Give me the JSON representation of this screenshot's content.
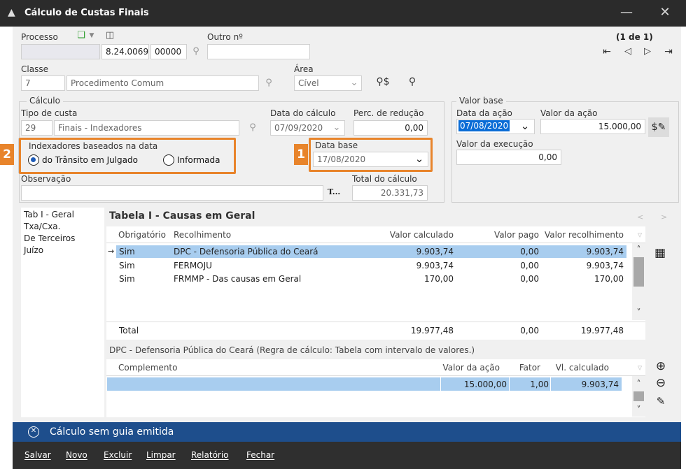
{
  "window": {
    "title": "Cálculo de Custas Finais"
  },
  "processo": {
    "label": "Processo",
    "numero": "8.24.0069",
    "sufixo": "00000",
    "outro_label": "Outro nº",
    "outro_value": ""
  },
  "paging": {
    "text": "(1 de 1)"
  },
  "classe": {
    "label": "Classe",
    "codigo": "7",
    "descricao": "Procedimento Comum"
  },
  "area": {
    "label": "Área",
    "value": "Cível"
  },
  "calculo": {
    "group_label": "Cálculo",
    "tipo_label": "Tipo de custa",
    "tipo_codigo": "29",
    "tipo_descricao": "Finais - Indexadores",
    "data_label": "Data do cálculo",
    "data_value": "07/09/2020",
    "perc_label": "Perc. de redução",
    "perc_value": "0,00",
    "indexadores_label": "Indexadores baseados na data",
    "radio1": "do Trânsito em Julgado",
    "radio2": "Informada",
    "data_base_label": "Data base",
    "data_base_value": "17/08/2020",
    "obs_label": "Observação",
    "t_button": "T...",
    "total_label": "Total do cálculo",
    "total_value": "20.331,73"
  },
  "valor_base": {
    "group_label": "Valor base",
    "data_acao_label": "Data da ação",
    "data_acao_value": "07/08/2020",
    "valor_acao_label": "Valor da ação",
    "valor_acao_value": "15.000,00",
    "valor_exec_label": "Valor da execução",
    "valor_exec_value": "0,00"
  },
  "badges": {
    "one": "1",
    "two": "2"
  },
  "tabs": [
    "Tab I - Geral",
    "Txa/Cxa.",
    "De Terceiros",
    "Juízo"
  ],
  "tabela": {
    "title": "Tabela I - Causas em Geral",
    "nav_prev": "<",
    "nav_next": ">",
    "headers": {
      "obrig": "Obrigatório",
      "recolh": "Recolhimento",
      "vcalc": "Valor calculado",
      "vpago": "Valor pago",
      "vrecolh": "Valor recolhimento"
    },
    "rows": [
      {
        "obrig": "Sim",
        "recolh": "DPC - Defensoria Pública do Ceará",
        "vcalc": "9.903,74",
        "vpago": "0,00",
        "vrecolh": "9.903,74"
      },
      {
        "obrig": "Sim",
        "recolh": "FERMOJU",
        "vcalc": "9.903,74",
        "vpago": "0,00",
        "vrecolh": "9.903,74"
      },
      {
        "obrig": "Sim",
        "recolh": "FRMMP - Das causas em Geral",
        "vcalc": "170,00",
        "vpago": "0,00",
        "vrecolh": "170,00"
      }
    ],
    "total": {
      "label": "Total",
      "vcalc": "19.977,48",
      "vpago": "0,00",
      "vrecolh": "19.977,48"
    }
  },
  "detalhe": {
    "caption": "DPC - Defensoria Pública do Ceará (Regra de cálculo: Tabela com intervalo de valores.)",
    "headers": {
      "comp": "Complemento",
      "vacao": "Valor da ação",
      "fator": "Fator",
      "vcalc": "Vl. calculado"
    },
    "row": {
      "comp": "",
      "vacao": "15.000,00",
      "fator": "1,00",
      "vcalc": "9.903,74"
    }
  },
  "status": {
    "text": "Cálculo sem guia emitida"
  },
  "menu": {
    "salvar": "Salvar",
    "novo": "Novo",
    "excluir": "Excluir",
    "limpar": "Limpar",
    "relatorio": "Relatório",
    "fechar": "Fechar"
  }
}
